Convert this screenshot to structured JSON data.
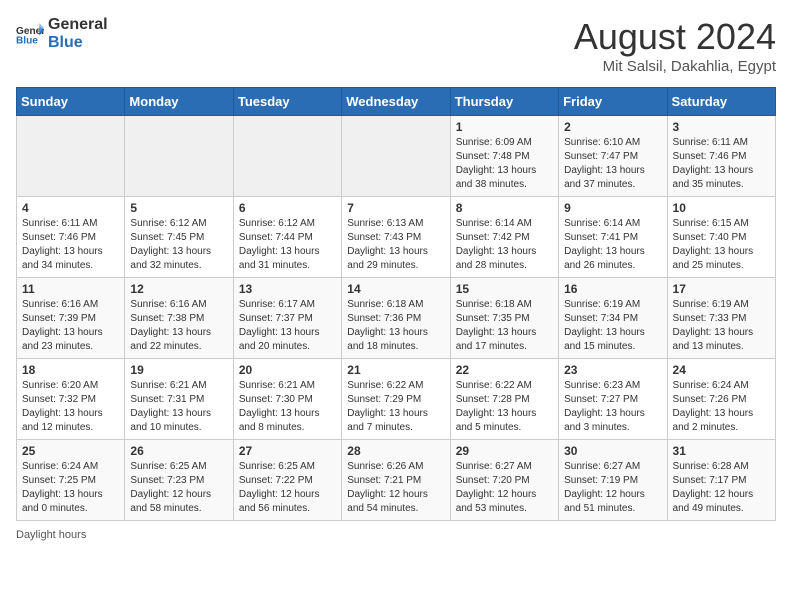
{
  "header": {
    "logo": {
      "general": "General",
      "blue": "Blue"
    },
    "title": "August 2024",
    "subtitle": "Mit Salsil, Dakahlia, Egypt"
  },
  "days_of_week": [
    "Sunday",
    "Monday",
    "Tuesday",
    "Wednesday",
    "Thursday",
    "Friday",
    "Saturday"
  ],
  "weeks": [
    [
      {
        "day": "",
        "info": ""
      },
      {
        "day": "",
        "info": ""
      },
      {
        "day": "",
        "info": ""
      },
      {
        "day": "",
        "info": ""
      },
      {
        "day": "1",
        "info": "Sunrise: 6:09 AM\nSunset: 7:48 PM\nDaylight: 13 hours and 38 minutes."
      },
      {
        "day": "2",
        "info": "Sunrise: 6:10 AM\nSunset: 7:47 PM\nDaylight: 13 hours and 37 minutes."
      },
      {
        "day": "3",
        "info": "Sunrise: 6:11 AM\nSunset: 7:46 PM\nDaylight: 13 hours and 35 minutes."
      }
    ],
    [
      {
        "day": "4",
        "info": "Sunrise: 6:11 AM\nSunset: 7:46 PM\nDaylight: 13 hours and 34 minutes."
      },
      {
        "day": "5",
        "info": "Sunrise: 6:12 AM\nSunset: 7:45 PM\nDaylight: 13 hours and 32 minutes."
      },
      {
        "day": "6",
        "info": "Sunrise: 6:12 AM\nSunset: 7:44 PM\nDaylight: 13 hours and 31 minutes."
      },
      {
        "day": "7",
        "info": "Sunrise: 6:13 AM\nSunset: 7:43 PM\nDaylight: 13 hours and 29 minutes."
      },
      {
        "day": "8",
        "info": "Sunrise: 6:14 AM\nSunset: 7:42 PM\nDaylight: 13 hours and 28 minutes."
      },
      {
        "day": "9",
        "info": "Sunrise: 6:14 AM\nSunset: 7:41 PM\nDaylight: 13 hours and 26 minutes."
      },
      {
        "day": "10",
        "info": "Sunrise: 6:15 AM\nSunset: 7:40 PM\nDaylight: 13 hours and 25 minutes."
      }
    ],
    [
      {
        "day": "11",
        "info": "Sunrise: 6:16 AM\nSunset: 7:39 PM\nDaylight: 13 hours and 23 minutes."
      },
      {
        "day": "12",
        "info": "Sunrise: 6:16 AM\nSunset: 7:38 PM\nDaylight: 13 hours and 22 minutes."
      },
      {
        "day": "13",
        "info": "Sunrise: 6:17 AM\nSunset: 7:37 PM\nDaylight: 13 hours and 20 minutes."
      },
      {
        "day": "14",
        "info": "Sunrise: 6:18 AM\nSunset: 7:36 PM\nDaylight: 13 hours and 18 minutes."
      },
      {
        "day": "15",
        "info": "Sunrise: 6:18 AM\nSunset: 7:35 PM\nDaylight: 13 hours and 17 minutes."
      },
      {
        "day": "16",
        "info": "Sunrise: 6:19 AM\nSunset: 7:34 PM\nDaylight: 13 hours and 15 minutes."
      },
      {
        "day": "17",
        "info": "Sunrise: 6:19 AM\nSunset: 7:33 PM\nDaylight: 13 hours and 13 minutes."
      }
    ],
    [
      {
        "day": "18",
        "info": "Sunrise: 6:20 AM\nSunset: 7:32 PM\nDaylight: 13 hours and 12 minutes."
      },
      {
        "day": "19",
        "info": "Sunrise: 6:21 AM\nSunset: 7:31 PM\nDaylight: 13 hours and 10 minutes."
      },
      {
        "day": "20",
        "info": "Sunrise: 6:21 AM\nSunset: 7:30 PM\nDaylight: 13 hours and 8 minutes."
      },
      {
        "day": "21",
        "info": "Sunrise: 6:22 AM\nSunset: 7:29 PM\nDaylight: 13 hours and 7 minutes."
      },
      {
        "day": "22",
        "info": "Sunrise: 6:22 AM\nSunset: 7:28 PM\nDaylight: 13 hours and 5 minutes."
      },
      {
        "day": "23",
        "info": "Sunrise: 6:23 AM\nSunset: 7:27 PM\nDaylight: 13 hours and 3 minutes."
      },
      {
        "day": "24",
        "info": "Sunrise: 6:24 AM\nSunset: 7:26 PM\nDaylight: 13 hours and 2 minutes."
      }
    ],
    [
      {
        "day": "25",
        "info": "Sunrise: 6:24 AM\nSunset: 7:25 PM\nDaylight: 13 hours and 0 minutes."
      },
      {
        "day": "26",
        "info": "Sunrise: 6:25 AM\nSunset: 7:23 PM\nDaylight: 12 hours and 58 minutes."
      },
      {
        "day": "27",
        "info": "Sunrise: 6:25 AM\nSunset: 7:22 PM\nDaylight: 12 hours and 56 minutes."
      },
      {
        "day": "28",
        "info": "Sunrise: 6:26 AM\nSunset: 7:21 PM\nDaylight: 12 hours and 54 minutes."
      },
      {
        "day": "29",
        "info": "Sunrise: 6:27 AM\nSunset: 7:20 PM\nDaylight: 12 hours and 53 minutes."
      },
      {
        "day": "30",
        "info": "Sunrise: 6:27 AM\nSunset: 7:19 PM\nDaylight: 12 hours and 51 minutes."
      },
      {
        "day": "31",
        "info": "Sunrise: 6:28 AM\nSunset: 7:17 PM\nDaylight: 12 hours and 49 minutes."
      }
    ]
  ],
  "footer": {
    "note": "Daylight hours"
  }
}
